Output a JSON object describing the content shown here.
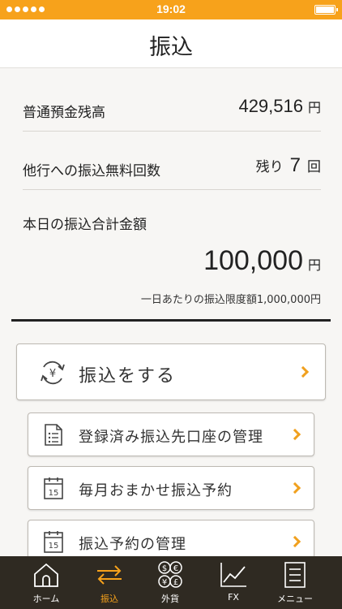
{
  "status_bar": {
    "time": "19:02"
  },
  "header": {
    "title": "振込"
  },
  "summary": {
    "balance_label": "普通預金残高",
    "balance_value": "429,516",
    "balance_unit": "円",
    "free_transfer_label": "他行への振込無料回数",
    "free_transfer_prefix": "残り",
    "free_transfer_count": "7",
    "free_transfer_unit": "回",
    "today_total_label": "本日の振込合計金額",
    "today_total_value": "100,000",
    "today_total_unit": "円",
    "daily_limit_note": "一日あたりの振込限度額1,000,000円"
  },
  "actions": {
    "transfer": "振込をする",
    "manage_accounts": "登録済み振込先口座の管理",
    "monthly_reservation": "毎月おまかせ振込予約",
    "manage_reservations": "振込予約の管理"
  },
  "calendar_day": "15",
  "tabs": [
    {
      "label": "ホーム"
    },
    {
      "label": "振込"
    },
    {
      "label": "外貨"
    },
    {
      "label": "FX"
    },
    {
      "label": "メニュー"
    }
  ],
  "colors": {
    "accent": "#f7a21b",
    "tab_bar": "#2f2a22",
    "background": "#f7f6f4"
  }
}
